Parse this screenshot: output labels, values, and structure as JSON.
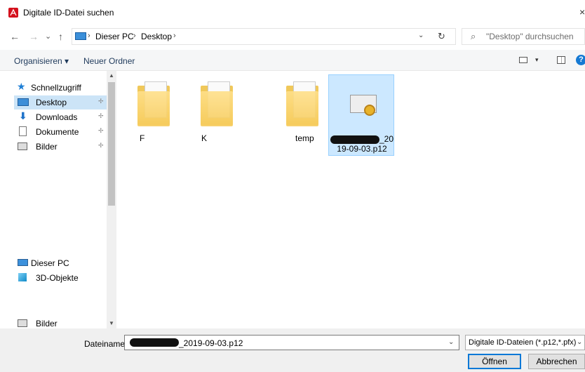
{
  "window": {
    "title": "Digitale ID-Datei suchen",
    "close": "×"
  },
  "nav": {
    "back": "←",
    "forward": "→",
    "recent": "⌄",
    "up": "↑",
    "path": [
      "Dieser PC",
      "Desktop"
    ],
    "separator": "›",
    "dropdown": "⌄",
    "refresh": "↻",
    "search_placeholder": "\"Desktop\" durchsuchen",
    "search_icon": "⌕"
  },
  "toolbar": {
    "organize": "Organisieren ▾",
    "new_folder": "Neuer Ordner",
    "view_dd": "▾",
    "help": "?"
  },
  "sidebar": {
    "quick_access": "Schnellzugriff",
    "items": [
      {
        "label": "Desktop",
        "icon": "desktop-icon",
        "pinned": true
      },
      {
        "label": "Downloads",
        "icon": "download-icon",
        "pinned": true
      },
      {
        "label": "Dokumente",
        "icon": "documents-icon",
        "pinned": true
      },
      {
        "label": "Bilder",
        "icon": "pictures-icon",
        "pinned": true
      }
    ],
    "this_pc": "Dieser PC",
    "objects3d": "3D-Objekte",
    "pictures2": "Bilder",
    "pin_glyph": "📌",
    "scroll_up": "▲",
    "scroll_down": "▼"
  },
  "files": [
    {
      "name": "F",
      "type": "folder"
    },
    {
      "name": "K",
      "type": "folder"
    },
    {
      "name": "temp",
      "type": "folder"
    },
    {
      "name_suffix_line1": "_20",
      "name_line2": "19-09-03.p12",
      "type": "certificate",
      "selected": true
    }
  ],
  "bottom": {
    "filename_label": "Dateiname:",
    "filename_value": "_2019-09-03.p12",
    "filetype": "Digitale ID-Dateien (*.p12,*.pfx)",
    "dd": "⌄",
    "open": "Öffnen",
    "cancel": "Abbrechen"
  },
  "colors": {
    "accent": "#0078d7",
    "selection": "#cce8ff",
    "adobe_red": "#d4111d"
  }
}
